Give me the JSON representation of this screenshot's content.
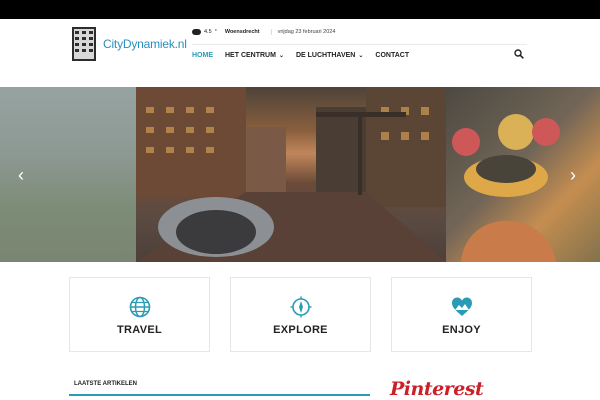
{
  "brand": {
    "name_part1": "City",
    "name_part2": "Dynamiek.nl"
  },
  "weather": {
    "temp": "4.5",
    "unit": "°",
    "location": "Woensdrecht",
    "condition_icon": "cloud-icon"
  },
  "date": "vrijdag 23 februari 2024",
  "nav": {
    "items": [
      {
        "label": "HOME",
        "active": true
      },
      {
        "label": "HET CENTRUM",
        "has_dropdown": true
      },
      {
        "label": "DE LUCHTHAVEN",
        "has_dropdown": true
      },
      {
        "label": "CONTACT"
      }
    ]
  },
  "slider": {
    "prev_icon": "chevron-left-icon",
    "next_icon": "chevron-right-icon"
  },
  "features": [
    {
      "label": "TRAVEL",
      "icon": "globe-icon"
    },
    {
      "label": "EXPLORE",
      "icon": "compass-icon"
    },
    {
      "label": "ENJOY",
      "icon": "heart-landscape-icon"
    }
  ],
  "sections": {
    "latest": "LAATSTE ARTIKELEN",
    "pinterest": "Pinterest"
  },
  "colors": {
    "accent": "#2a9bb5",
    "pinterest": "#cb2027"
  }
}
